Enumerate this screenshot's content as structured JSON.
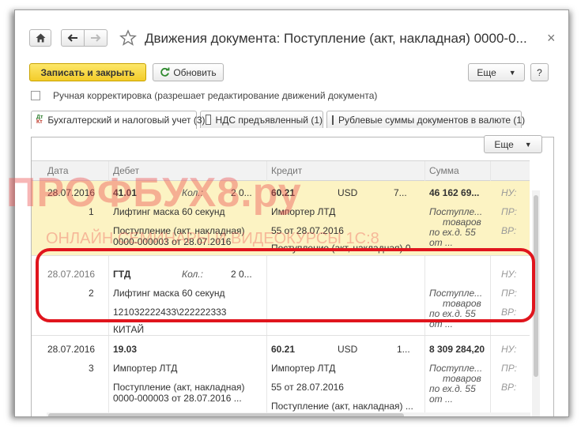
{
  "window": {
    "title": "Движения документа: Поступление (акт, накладная) 0000-0...",
    "close_glyph": "×"
  },
  "toolbar": {
    "save_close_label": "Записать и закрыть",
    "refresh_label": "Обновить",
    "more_label": "Еще",
    "help_label": "?"
  },
  "manual_edit": {
    "label": "Ручная корректировка (разрешает редактирование движений документа)"
  },
  "tabs": [
    {
      "label": "Бухгалтерский и налоговый учет (3)",
      "active": true
    },
    {
      "label": "НДС предъявленный (1)",
      "active": false
    },
    {
      "label": "Рублевые суммы документов в валюте (1)",
      "active": false
    }
  ],
  "panel": {
    "more_label": "Еще"
  },
  "grid": {
    "columns": [
      "Дата",
      "Дебет",
      "Кредит",
      "Сумма"
    ],
    "rows": [
      {
        "date": "28.07.2016",
        "num": "1",
        "debit_account": "41.01",
        "debit_qty_label": "Кол.:",
        "debit_qty": "2 0...",
        "debit_sub1": "Лифтинг маска 60 секунд",
        "debit_sub2a": "Поступление (акт, накладная)",
        "debit_sub2b": "0000-000003 от 28.07.2016",
        "credit_account": "60.21",
        "credit_currency": "USD",
        "credit_amount_cur": "7...",
        "credit_sub1": "Импортер ЛТД",
        "credit_sub2": "55 от 28.07.2016",
        "credit_sub3": "Поступление (акт, накладная) 0...",
        "amount": "46 162 69...",
        "content1": "Поступле...",
        "content2": "товаров",
        "content3": "по ех.д. 55",
        "content4": "от ...",
        "nu": "НУ:",
        "pr": "ПР:",
        "vr": "ВР:"
      },
      {
        "date": "28.07.2016",
        "num": "2",
        "debit_account": "ГТД",
        "debit_qty_label": "Кол.:",
        "debit_qty": "2 0...",
        "debit_sub1": "Лифтинг маска 60 секунд",
        "debit_sub2a": "121032222433\\222222333",
        "debit_sub3": "КИТАЙ",
        "content1": "Поступле...",
        "content2": "товаров",
        "content3": "по ех.д. 55",
        "content4": "от ...",
        "nu": "НУ:",
        "pr": "ПР:",
        "vr": "ВР:"
      },
      {
        "date": "28.07.2016",
        "num": "3",
        "debit_account": "19.03",
        "debit_sub1": "Импортер ЛТД",
        "debit_sub2a": "Поступление (акт, накладная)",
        "debit_sub2b": "0000-000003 от 28.07.2016 ...",
        "credit_account": "60.21",
        "credit_currency": "USD",
        "credit_amount_cur": "1...",
        "credit_sub1": "Импортер ЛТД",
        "credit_sub2": "55 от 28.07.2016",
        "credit_sub3": "Поступление (акт, накладная) ...",
        "amount": "8 309 284,20",
        "content1": "Поступле...",
        "content2": "товаров",
        "content3": "по ех.д. 55",
        "content4": "от ...",
        "nu": "НУ:",
        "pr": "ПР:",
        "vr": "ВР:"
      }
    ]
  },
  "watermark": {
    "main": "ПРОФБУХ8.ру",
    "sub": "ОНЛАЙН СЕМИНАРЫ И ВИДЕОКУРСЫ 1С:8"
  },
  "colors": {
    "selected_row": "#fcf3c3",
    "primary_button": "#f5d13a",
    "highlight_frame": "#e0151d",
    "watermark": "#ec5050"
  }
}
